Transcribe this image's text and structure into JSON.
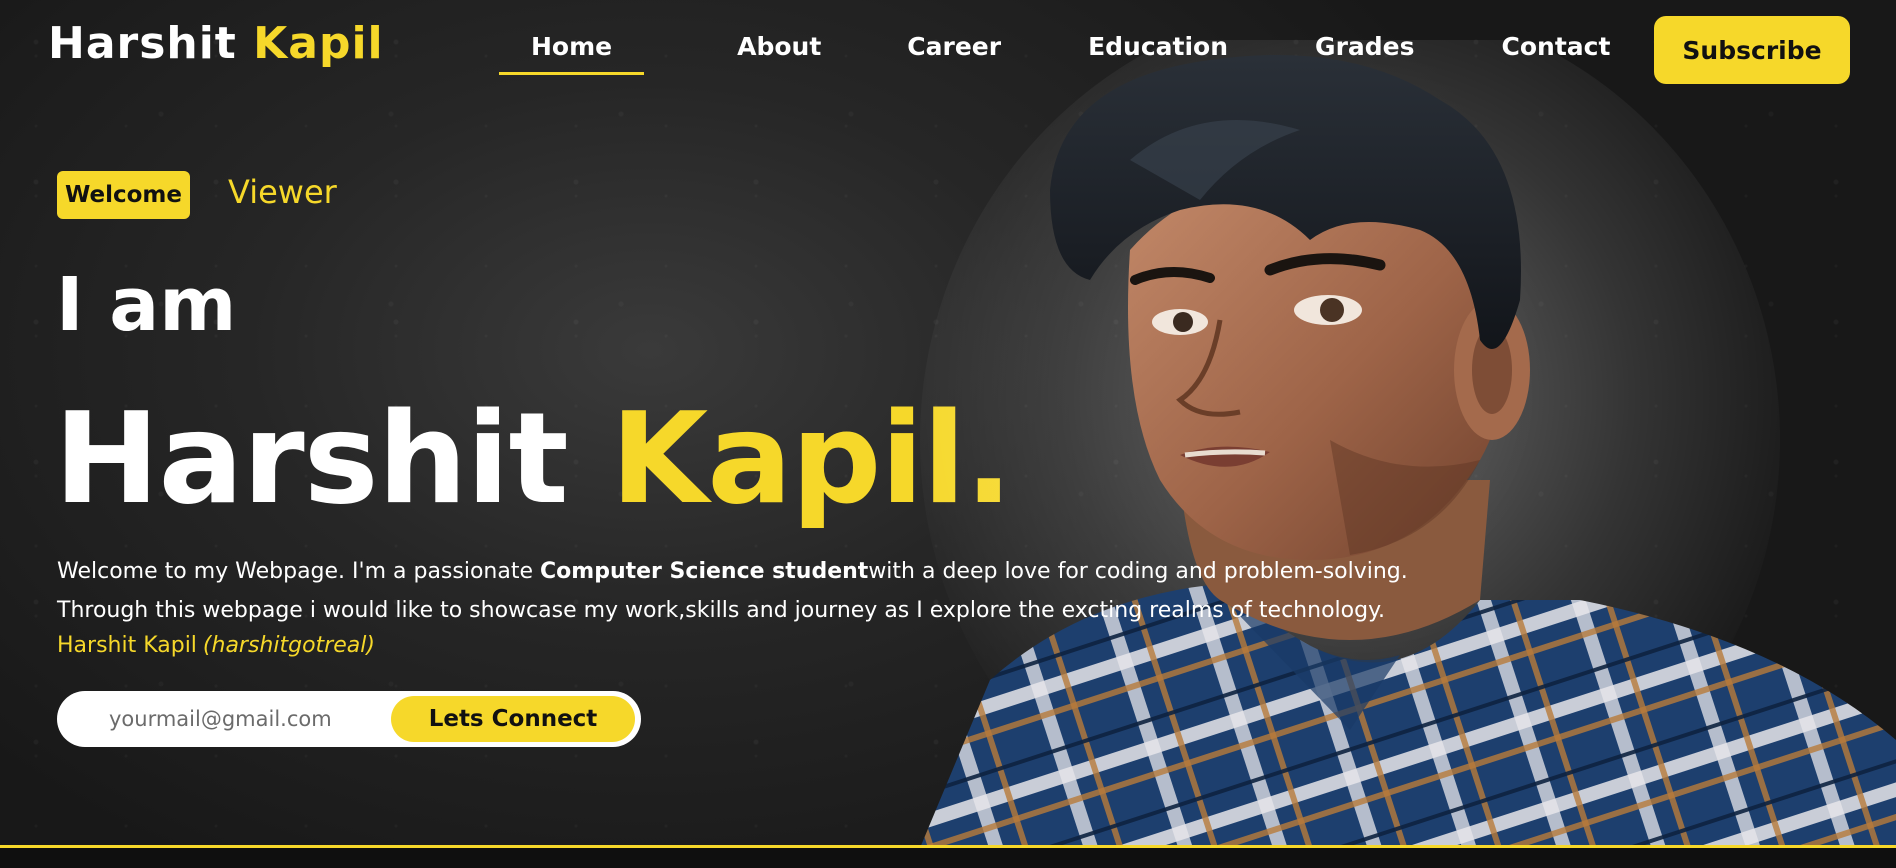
{
  "brand": {
    "first_name": "Harshit",
    "last_name": "Kapil"
  },
  "nav": {
    "items": [
      {
        "label": "Home",
        "active": true
      },
      {
        "label": "About",
        "active": false
      },
      {
        "label": "Career",
        "active": false
      },
      {
        "label": "Education",
        "active": false
      },
      {
        "label": "Grades",
        "active": false
      },
      {
        "label": "Contact",
        "active": false
      }
    ],
    "subscribe_label": "Subscribe"
  },
  "hero": {
    "badge": "Welcome",
    "greeting_target": "Viewer",
    "intro_prefix": "I am",
    "name_first": "Harshit",
    "name_last": "Kapil.",
    "description_part1": "Welcome to my Webpage. I'm a passionate ",
    "description_bold": "Computer Science student",
    "description_part2": "with a deep love for coding and problem-solving.",
    "description_line2": "Through this webpage i would like to showcase my work,skills and journey as I explore the excting realms of technology.",
    "signature_name": "Harshit Kapil",
    "signature_handle": "(harshitgotreal)"
  },
  "connect": {
    "email_placeholder": "yourmail@gmail.com",
    "email_value": "",
    "button_label": "Lets Connect"
  },
  "colors": {
    "accent": "#f6d82a",
    "background": "#1e1e1e",
    "text": "#ffffff"
  }
}
